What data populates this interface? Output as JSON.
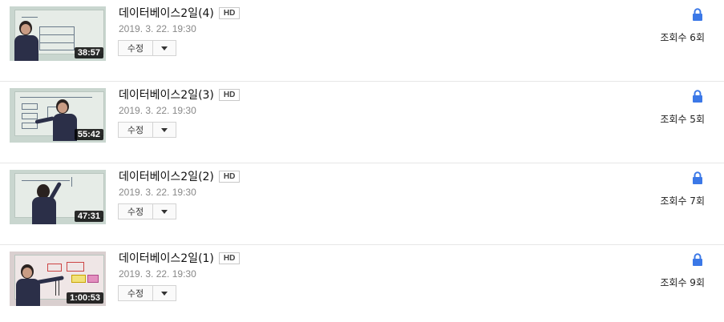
{
  "videos": [
    {
      "title": "데이터베이스2일(4)",
      "quality": "HD",
      "date": "2019. 3. 22. 19:30",
      "duration": "38:57",
      "edit_label": "수정",
      "views": "조회수 6회",
      "privacy_icon": "lock-icon"
    },
    {
      "title": "데이터베이스2일(3)",
      "quality": "HD",
      "date": "2019. 3. 22. 19:30",
      "duration": "55:42",
      "edit_label": "수정",
      "views": "조회수 5회",
      "privacy_icon": "lock-icon"
    },
    {
      "title": "데이터베이스2일(2)",
      "quality": "HD",
      "date": "2019. 3. 22. 19:30",
      "duration": "47:31",
      "edit_label": "수정",
      "views": "조회수 7회",
      "privacy_icon": "lock-icon"
    },
    {
      "title": "데이터베이스2일(1)",
      "quality": "HD",
      "date": "2019. 3. 22. 19:30",
      "duration": "1:00:53",
      "edit_label": "수정",
      "views": "조회수 9회",
      "privacy_icon": "lock-icon"
    }
  ],
  "colors": {
    "lock": "#3b78e7",
    "duration_bg": "#1a1a1a",
    "divider": "#e6e6e6"
  }
}
